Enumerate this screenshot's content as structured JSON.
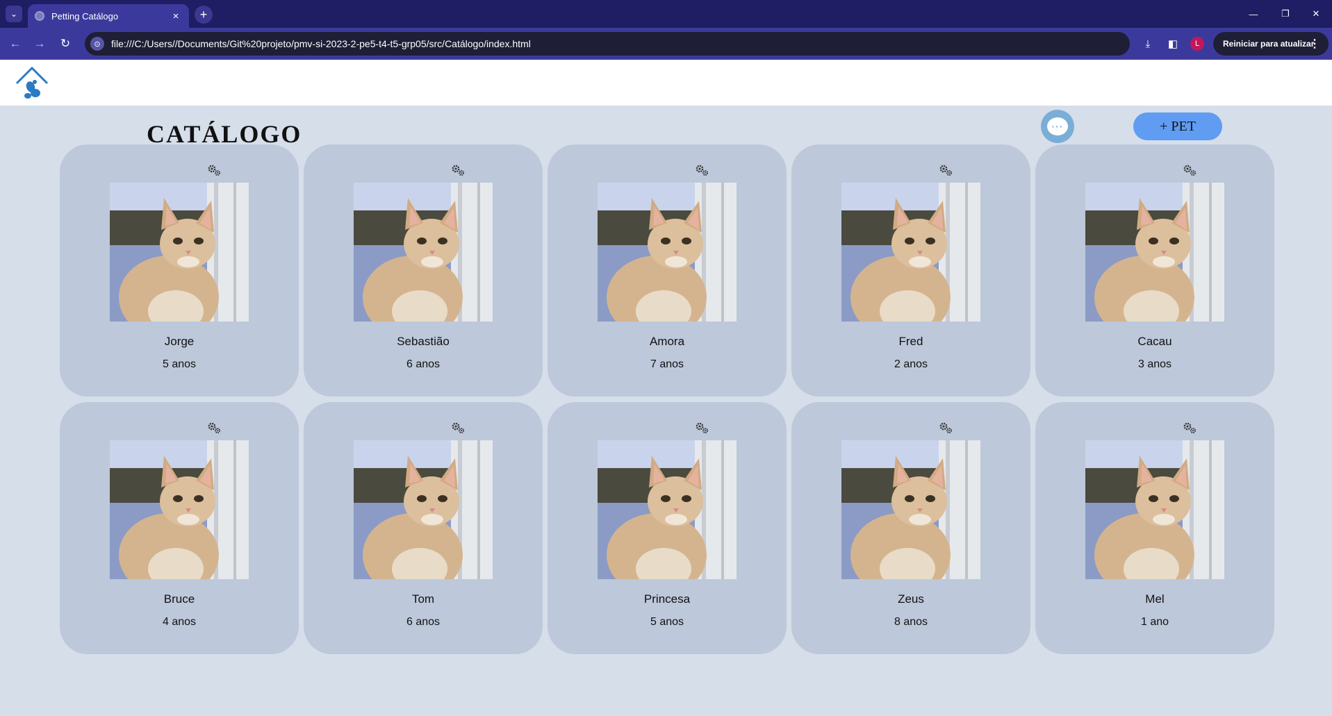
{
  "browser": {
    "tab_title": "Petting Catálogo",
    "tab_close": "×",
    "new_tab": "+",
    "url": "file:///C:/Users//Documents/Git%20projeto/pmv-si-2023-2-pe5-t4-t5-grp05/src/Catálogo/index.html",
    "profile_initial": "L",
    "update_label": "Reiniciar para atualizar"
  },
  "page": {
    "title": "CATÁLOGO",
    "add_pet_label": "+ PET",
    "chat_dots": "···"
  },
  "pets": [
    {
      "name": "Jorge",
      "age": "5 anos"
    },
    {
      "name": "Sebastião",
      "age": "6 anos"
    },
    {
      "name": "Amora",
      "age": "7 anos"
    },
    {
      "name": "Fred",
      "age": "2 anos"
    },
    {
      "name": "Cacau",
      "age": "3 anos"
    },
    {
      "name": "Bruce",
      "age": "4 anos"
    },
    {
      "name": "Tom",
      "age": "6 anos"
    },
    {
      "name": "Princesa",
      "age": "5 anos"
    },
    {
      "name": "Zeus",
      "age": "8 anos"
    },
    {
      "name": "Mel",
      "age": "1 ano"
    }
  ],
  "icons": {
    "card_settings": "gears-icon",
    "pet_photo": "cat-photo",
    "logo": "pet-house-logo"
  },
  "colors": {
    "chrome_dark": "#1f1d63",
    "chrome": "#3b3a9c",
    "page_bg": "#d6dee9",
    "card_bg": "#bdc8da",
    "add_button": "#5f9cf2",
    "chat_button": "#7aaed6"
  }
}
